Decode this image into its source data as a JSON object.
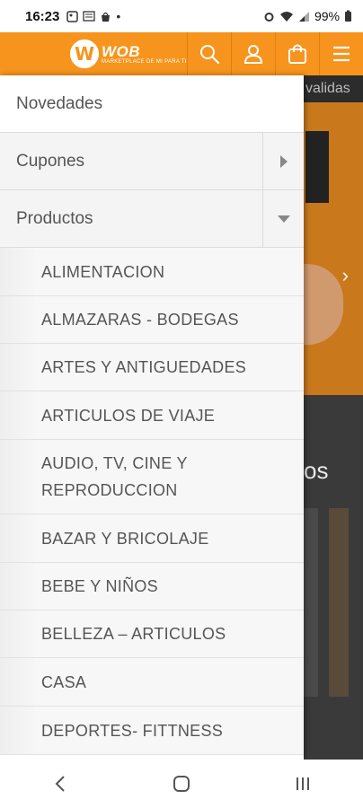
{
  "status_bar": {
    "time": "16:23",
    "battery": "99%"
  },
  "header": {
    "logo_text": "WOB",
    "logo_sub": "MARKETPLACE DE MI PARA TI",
    "brand_color": "#f7941d",
    "icons": [
      "search-icon",
      "user-icon",
      "bag-icon",
      "menu-icon"
    ]
  },
  "menu": {
    "items": [
      {
        "label": "Novedades"
      },
      {
        "label": "Cupones"
      },
      {
        "label": "Productos"
      }
    ],
    "subitems": [
      "ALIMENTACION",
      "ALMAZARAS - BODEGAS",
      "ARTES Y ANTIGUEDADES",
      "ARTICULOS DE VIAJE",
      "AUDIO, TV, CINE Y REPRODUCCION",
      "BAZAR Y BRICOLAJE",
      "BEBE Y NIÑOS",
      "BELLEZA – ARTICULOS",
      "CASA",
      "DEPORTES- FITTNESS"
    ]
  },
  "background": {
    "strip_text": "validas",
    "section_title_fragment": "os"
  }
}
